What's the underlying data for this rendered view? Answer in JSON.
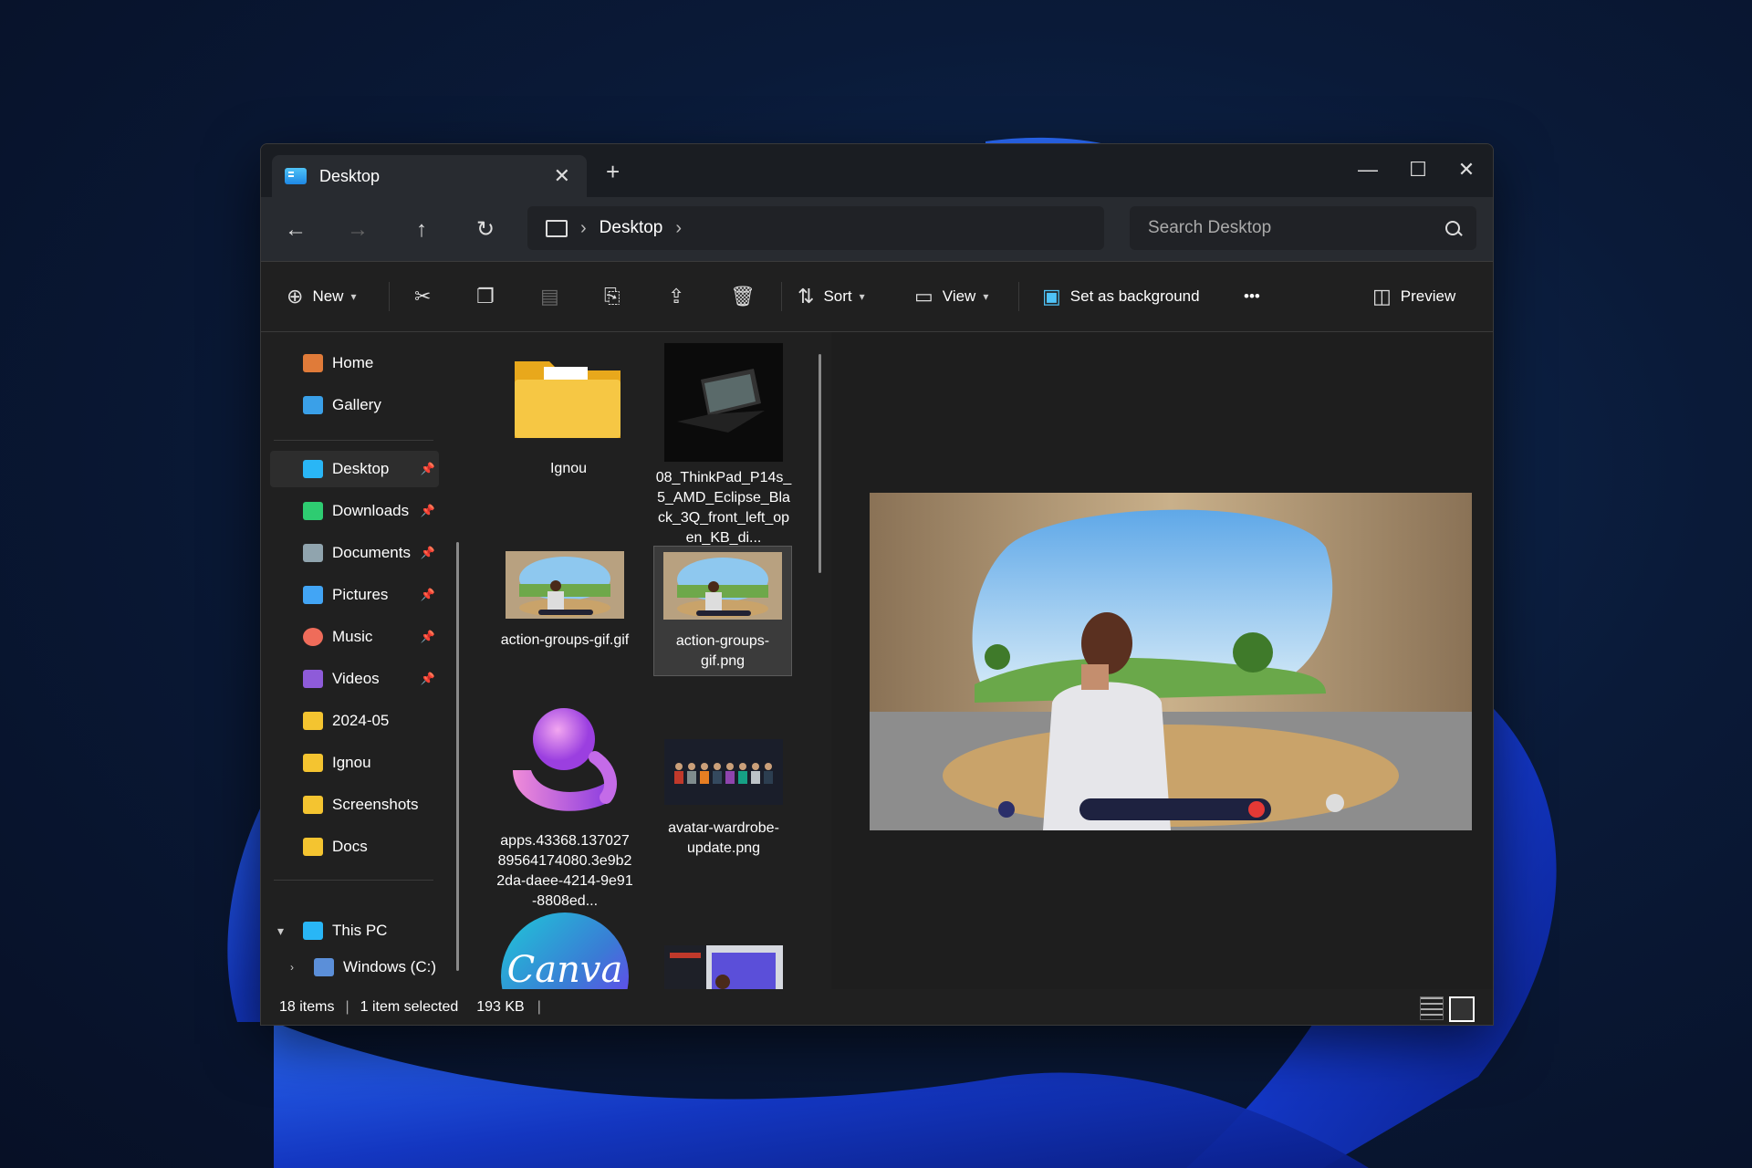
{
  "window": {
    "tab_title": "Desktop",
    "tab_close": "✕",
    "new_tab": "+",
    "minimize": "—",
    "maximize": "☐",
    "close": "✕"
  },
  "nav": {
    "back": "←",
    "forward": "→",
    "up": "↑",
    "refresh": "↻",
    "breadcrumb": "Desktop",
    "search_placeholder": "Search Desktop"
  },
  "toolbar": {
    "new_label": "New",
    "sort_label": "Sort",
    "view_label": "View",
    "set_bg_label": "Set as background",
    "more_label": "•••",
    "preview_label": "Preview"
  },
  "sidebar": {
    "items": [
      {
        "label": "Home",
        "color": "#e07b39",
        "pinned": false
      },
      {
        "label": "Gallery",
        "color": "#3aa0e8",
        "pinned": false
      },
      {
        "label": "Desktop",
        "color": "#29b6f6",
        "pinned": true
      },
      {
        "label": "Downloads",
        "color": "#2ecc71",
        "pinned": true
      },
      {
        "label": "Documents",
        "color": "#90a4ae",
        "pinned": true
      },
      {
        "label": "Pictures",
        "color": "#42a5f5",
        "pinned": true
      },
      {
        "label": "Music",
        "color": "#ef6c5a",
        "pinned": true
      },
      {
        "label": "Videos",
        "color": "#8e5bd9",
        "pinned": true
      },
      {
        "label": "2024-05",
        "color": "#f4c430",
        "pinned": false
      },
      {
        "label": "Ignou",
        "color": "#f4c430",
        "pinned": false
      },
      {
        "label": "Screenshots",
        "color": "#f4c430",
        "pinned": false
      },
      {
        "label": "Docs",
        "color": "#f4c430",
        "pinned": false
      }
    ],
    "this_pc": "This PC",
    "windows_drive": "Windows (C:)"
  },
  "files": [
    {
      "name": "Ignou",
      "type": "folder"
    },
    {
      "name": "08_ThinkPad_P14s_5_AMD_Eclipse_Black_3Q_front_left_open_KB_di...",
      "type": "laptop"
    },
    {
      "name": "action-groups-gif.gif",
      "type": "scene"
    },
    {
      "name": "action-groups-gif.png",
      "type": "scene"
    },
    {
      "name": "apps.43368.13702789564174080.3e9b22da-daee-4214-9e91-8808ed...",
      "type": "appicon"
    },
    {
      "name": "avatar-wardrobe-update.png",
      "type": "avatars"
    },
    {
      "name": "Canva",
      "type": "canva"
    },
    {
      "name": "",
      "type": "screenshot"
    }
  ],
  "canva_text": "Canva",
  "status": {
    "items": "18 items",
    "selected": "1 item selected",
    "size": "193 KB"
  }
}
